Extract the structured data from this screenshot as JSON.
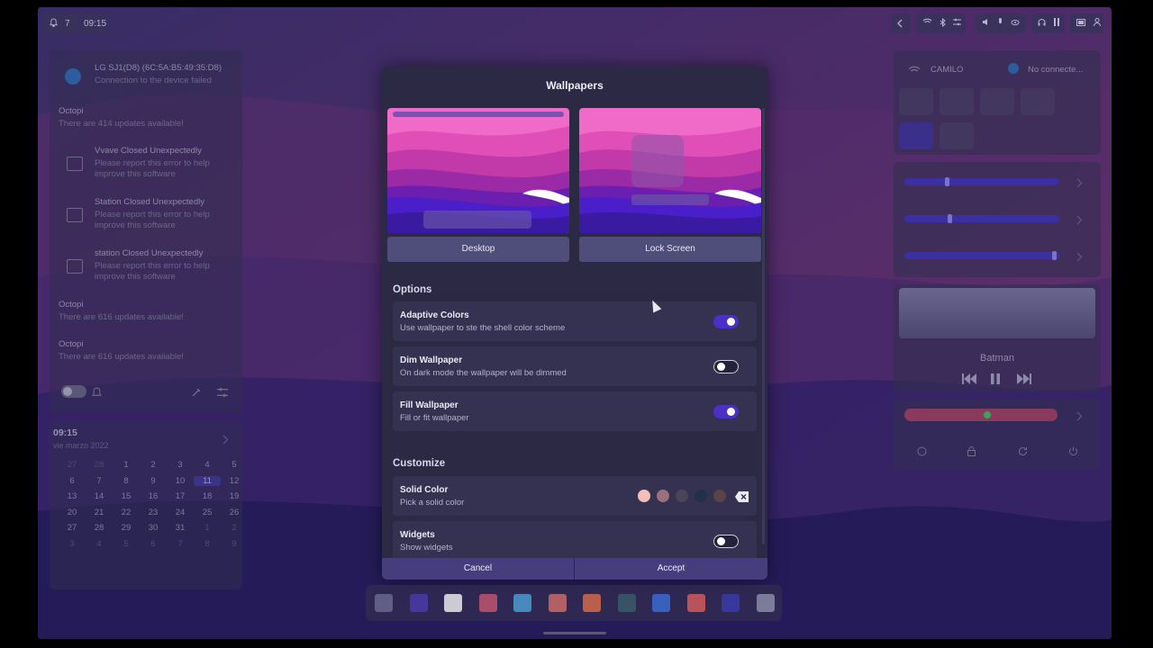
{
  "topbar": {
    "notif_count": "7",
    "clock": "09:15"
  },
  "notifications": [
    {
      "title": "LG SJ1(D8) (6C:5A:B5:49:35:D8)",
      "body": [
        "Connection to the device failed"
      ],
      "icon": "bluetooth-icon"
    },
    {
      "title": "Octopi",
      "body": [
        "There are 414 updates available!"
      ],
      "icon": ""
    },
    {
      "title": "Vvave Closed Unexpectedly",
      "body": [
        "Please report this error to help",
        "improve this software"
      ],
      "icon": "image-icon"
    },
    {
      "title": "Station Closed Unexpectedly",
      "body": [
        "Please report this error to help",
        "improve this software"
      ],
      "icon": "image-icon"
    },
    {
      "title": "station Closed Unexpectedly",
      "body": [
        "Please report this error to help",
        "improve this software"
      ],
      "icon": "image-icon"
    },
    {
      "title": "Octopi",
      "body": [
        "There are 616 updates available!"
      ],
      "icon": ""
    },
    {
      "title": "Octopi",
      "body": [
        "There are 616 updates available!"
      ],
      "icon": ""
    }
  ],
  "calendar": {
    "time": "09:15",
    "date": "vie marzo 2022",
    "days": [
      "27",
      "28",
      "1",
      "2",
      "3",
      "4",
      "5",
      "6",
      "7",
      "8",
      "9",
      "10",
      "11",
      "12",
      "13",
      "14",
      "15",
      "16",
      "17",
      "18",
      "19",
      "20",
      "21",
      "22",
      "23",
      "24",
      "25",
      "26",
      "27",
      "28",
      "29",
      "30",
      "31",
      "1",
      "2",
      "3",
      "4",
      "5",
      "6",
      "7",
      "8",
      "9"
    ],
    "today": "11"
  },
  "quick_settings": {
    "wifi_label": "CAMILO",
    "bt_label": "No connecte..."
  },
  "sliders": [
    0.3,
    0.32,
    1.0
  ],
  "media": {
    "title": "Batman"
  },
  "battery": {
    "level": 0.52
  },
  "dialog": {
    "title": "Wallpapers",
    "desktop_label": "Desktop",
    "lockscreen_label": "Lock Screen",
    "options_header": "Options",
    "options": [
      {
        "title": "Adaptive Colors",
        "subtitle": "Use wallpaper to ste the shell color scheme",
        "on": true
      },
      {
        "title": "Dim Wallpaper",
        "subtitle": "On dark mode the wallpaper will be dimmed",
        "on": false
      },
      {
        "title": "Fill Wallpaper",
        "subtitle": "Fill or fit wallpaper",
        "on": true
      }
    ],
    "customize_header": "Customize",
    "solid_color": {
      "title": "Solid Color",
      "subtitle": "Pick a solid color",
      "swatches": [
        "#f2c0b8",
        "#9c6f7e",
        "#4b4357",
        "#233049",
        "#5a4447"
      ]
    },
    "widgets": {
      "title": "Widgets",
      "subtitle": "Show widgets",
      "on": false
    },
    "cancel_label": "Cancel",
    "accept_label": "Accept"
  },
  "dock_icons": [
    "apps-icon",
    "podcast-icon",
    "notion-icon",
    "audio-icon",
    "files-icon",
    "gallery-icon",
    "store-icon",
    "terminal-icon",
    "maui-icon",
    "calendar-icon",
    "camera-icon",
    "window-icon"
  ]
}
